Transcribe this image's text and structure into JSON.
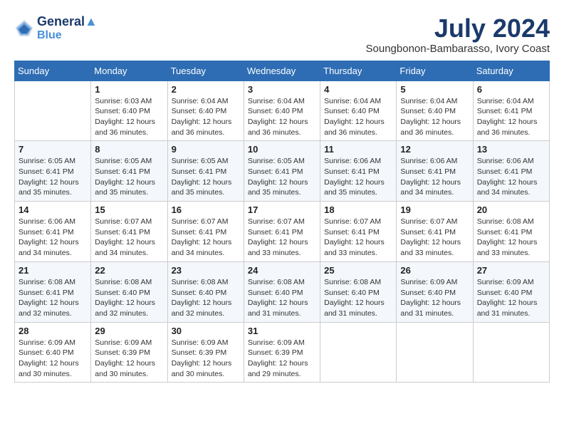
{
  "header": {
    "logo_line1": "General",
    "logo_line2": "Blue",
    "month": "July 2024",
    "location": "Soungbonon-Bambarasso, Ivory Coast"
  },
  "days_of_week": [
    "Sunday",
    "Monday",
    "Tuesday",
    "Wednesday",
    "Thursday",
    "Friday",
    "Saturday"
  ],
  "weeks": [
    [
      {
        "day": "",
        "info": ""
      },
      {
        "day": "1",
        "info": "Sunrise: 6:03 AM\nSunset: 6:40 PM\nDaylight: 12 hours\nand 36 minutes."
      },
      {
        "day": "2",
        "info": "Sunrise: 6:04 AM\nSunset: 6:40 PM\nDaylight: 12 hours\nand 36 minutes."
      },
      {
        "day": "3",
        "info": "Sunrise: 6:04 AM\nSunset: 6:40 PM\nDaylight: 12 hours\nand 36 minutes."
      },
      {
        "day": "4",
        "info": "Sunrise: 6:04 AM\nSunset: 6:40 PM\nDaylight: 12 hours\nand 36 minutes."
      },
      {
        "day": "5",
        "info": "Sunrise: 6:04 AM\nSunset: 6:40 PM\nDaylight: 12 hours\nand 36 minutes."
      },
      {
        "day": "6",
        "info": "Sunrise: 6:04 AM\nSunset: 6:41 PM\nDaylight: 12 hours\nand 36 minutes."
      }
    ],
    [
      {
        "day": "7",
        "info": "Sunrise: 6:05 AM\nSunset: 6:41 PM\nDaylight: 12 hours\nand 35 minutes."
      },
      {
        "day": "8",
        "info": "Sunrise: 6:05 AM\nSunset: 6:41 PM\nDaylight: 12 hours\nand 35 minutes."
      },
      {
        "day": "9",
        "info": "Sunrise: 6:05 AM\nSunset: 6:41 PM\nDaylight: 12 hours\nand 35 minutes."
      },
      {
        "day": "10",
        "info": "Sunrise: 6:05 AM\nSunset: 6:41 PM\nDaylight: 12 hours\nand 35 minutes."
      },
      {
        "day": "11",
        "info": "Sunrise: 6:06 AM\nSunset: 6:41 PM\nDaylight: 12 hours\nand 35 minutes."
      },
      {
        "day": "12",
        "info": "Sunrise: 6:06 AM\nSunset: 6:41 PM\nDaylight: 12 hours\nand 34 minutes."
      },
      {
        "day": "13",
        "info": "Sunrise: 6:06 AM\nSunset: 6:41 PM\nDaylight: 12 hours\nand 34 minutes."
      }
    ],
    [
      {
        "day": "14",
        "info": "Sunrise: 6:06 AM\nSunset: 6:41 PM\nDaylight: 12 hours\nand 34 minutes."
      },
      {
        "day": "15",
        "info": "Sunrise: 6:07 AM\nSunset: 6:41 PM\nDaylight: 12 hours\nand 34 minutes."
      },
      {
        "day": "16",
        "info": "Sunrise: 6:07 AM\nSunset: 6:41 PM\nDaylight: 12 hours\nand 34 minutes."
      },
      {
        "day": "17",
        "info": "Sunrise: 6:07 AM\nSunset: 6:41 PM\nDaylight: 12 hours\nand 33 minutes."
      },
      {
        "day": "18",
        "info": "Sunrise: 6:07 AM\nSunset: 6:41 PM\nDaylight: 12 hours\nand 33 minutes."
      },
      {
        "day": "19",
        "info": "Sunrise: 6:07 AM\nSunset: 6:41 PM\nDaylight: 12 hours\nand 33 minutes."
      },
      {
        "day": "20",
        "info": "Sunrise: 6:08 AM\nSunset: 6:41 PM\nDaylight: 12 hours\nand 33 minutes."
      }
    ],
    [
      {
        "day": "21",
        "info": "Sunrise: 6:08 AM\nSunset: 6:41 PM\nDaylight: 12 hours\nand 32 minutes."
      },
      {
        "day": "22",
        "info": "Sunrise: 6:08 AM\nSunset: 6:40 PM\nDaylight: 12 hours\nand 32 minutes."
      },
      {
        "day": "23",
        "info": "Sunrise: 6:08 AM\nSunset: 6:40 PM\nDaylight: 12 hours\nand 32 minutes."
      },
      {
        "day": "24",
        "info": "Sunrise: 6:08 AM\nSunset: 6:40 PM\nDaylight: 12 hours\nand 31 minutes."
      },
      {
        "day": "25",
        "info": "Sunrise: 6:08 AM\nSunset: 6:40 PM\nDaylight: 12 hours\nand 31 minutes."
      },
      {
        "day": "26",
        "info": "Sunrise: 6:09 AM\nSunset: 6:40 PM\nDaylight: 12 hours\nand 31 minutes."
      },
      {
        "day": "27",
        "info": "Sunrise: 6:09 AM\nSunset: 6:40 PM\nDaylight: 12 hours\nand 31 minutes."
      }
    ],
    [
      {
        "day": "28",
        "info": "Sunrise: 6:09 AM\nSunset: 6:40 PM\nDaylight: 12 hours\nand 30 minutes."
      },
      {
        "day": "29",
        "info": "Sunrise: 6:09 AM\nSunset: 6:39 PM\nDaylight: 12 hours\nand 30 minutes."
      },
      {
        "day": "30",
        "info": "Sunrise: 6:09 AM\nSunset: 6:39 PM\nDaylight: 12 hours\nand 30 minutes."
      },
      {
        "day": "31",
        "info": "Sunrise: 6:09 AM\nSunset: 6:39 PM\nDaylight: 12 hours\nand 29 minutes."
      },
      {
        "day": "",
        "info": ""
      },
      {
        "day": "",
        "info": ""
      },
      {
        "day": "",
        "info": ""
      }
    ]
  ]
}
